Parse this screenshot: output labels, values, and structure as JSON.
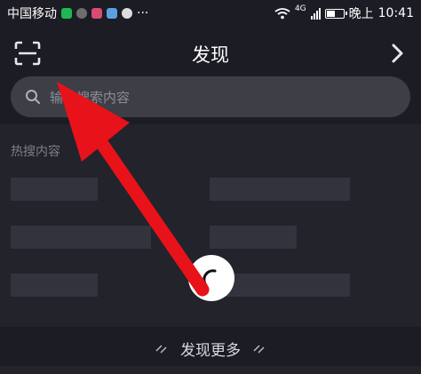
{
  "status_bar": {
    "carrier": "中国移动",
    "more_dots": "···",
    "network_type": "4G",
    "time_prefix": "晚上",
    "time": "10:41",
    "battery_level": 0.55
  },
  "header": {
    "title": "发现",
    "scan_icon": "scan-icon",
    "forward_icon": "chevron-right-icon"
  },
  "search": {
    "placeholder": "输入搜索内容",
    "icon": "search-icon"
  },
  "hot_search": {
    "title": "热搜内容",
    "placeholder_count": 6
  },
  "footer": {
    "more_label": "发现更多"
  },
  "colors": {
    "background": "#1c1c24",
    "panel": "#23232c",
    "placeholder": "#33333d",
    "search_bg": "#3e3e46",
    "annotation_arrow": "#e8121a"
  }
}
